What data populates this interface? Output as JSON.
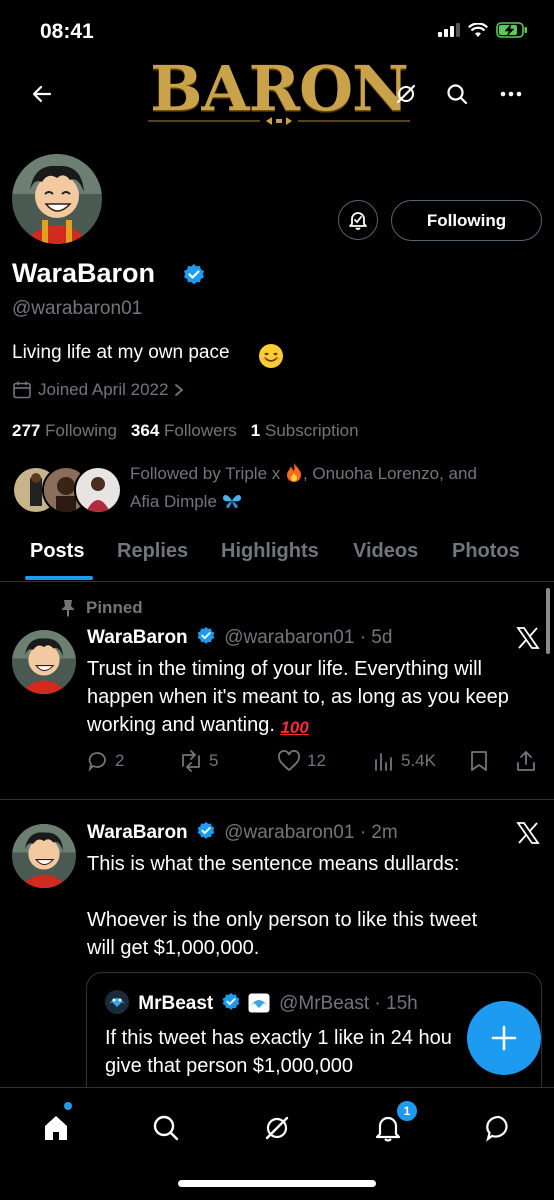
{
  "status_bar": {
    "time": "08:41"
  },
  "header": {
    "banner_text": "BARON"
  },
  "profile": {
    "display_name": "WaraBaron",
    "handle": "@warabaron01",
    "bio": "Living life at my own pace",
    "joined": "Joined April 2022",
    "following_button": "Following",
    "stats": {
      "following_count": "277",
      "following_label": "Following",
      "followers_count": "364",
      "followers_label": "Followers",
      "subscription_count": "1",
      "subscription_label": "Subscription"
    },
    "followed_by": {
      "prefix": "Followed by ",
      "name1": "Triple x",
      "middle": ", Onuoha Lorenzo, and",
      "name3": "Afia Dimple"
    }
  },
  "tabs": [
    {
      "label": "Posts",
      "active": true
    },
    {
      "label": "Replies"
    },
    {
      "label": "Highlights"
    },
    {
      "label": "Videos"
    },
    {
      "label": "Photos"
    }
  ],
  "tweets": [
    {
      "pinned_label": "Pinned",
      "name": "WaraBaron",
      "handle_time": "@warabaron01 · 5d",
      "text_lines": [
        "Trust in the timing of your life. Everything will",
        "happen when it's meant to, as long as you keep",
        "working and wanting."
      ],
      "replies": "2",
      "reposts": "5",
      "likes": "12",
      "views": "5.4K"
    },
    {
      "name": "WaraBaron",
      "handle_time": "@warabaron01 · 2m",
      "text_line1": "This is what the sentence means dullards:",
      "text_line2": "Whoever is the only person to like this tweet",
      "text_line3": "will get $1,000,000.",
      "quote": {
        "name": "MrBeast",
        "handle_time": "@MrBeast · 15h",
        "line1": "If this tweet has exactly 1 like in 24 hou",
        "line2": "give that person $1,000,000"
      }
    }
  ],
  "bottom_nav": {
    "notifications_badge": "1"
  },
  "colors": {
    "accent": "#1d9bf0",
    "background": "#000000",
    "muted": "#71767b",
    "gold": "#c9a24a"
  }
}
